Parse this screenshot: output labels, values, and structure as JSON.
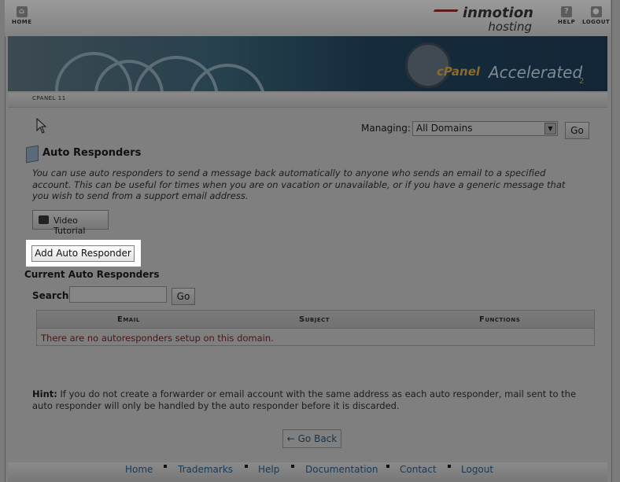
{
  "topbar": {
    "home_label": "HOME",
    "help_label": "HELP",
    "logout_label": "LOGOUT",
    "logo_line1": "inmotion",
    "logo_line2": "hosting"
  },
  "banner": {
    "brand_word1": "cPanel",
    "brand_word2": "Accelerated",
    "brand_suffix": "2"
  },
  "breadcrumb": "CPANEL 11",
  "managing": {
    "label": "Managing:",
    "selected": "All Domains",
    "go_label": "Go"
  },
  "page": {
    "title": "Auto Responders",
    "description": "You can use auto responders to send a message back automatically to anyone who sends an email to a specified account. This can be useful for times when you are on vacation or unavailable, or if you have a generic message that you wish to send from a support email address.",
    "video_tutorial_label": "Video Tutorial",
    "add_button_label": "Add Auto Responder",
    "current_heading": "Current Auto Responders"
  },
  "search": {
    "label": "Search",
    "value": "",
    "go_label": "Go"
  },
  "table": {
    "columns": [
      "Email",
      "Subject",
      "Functions"
    ],
    "empty_message": "There are no autoresponders setup on this domain."
  },
  "hint": {
    "label": "Hint:",
    "text": " If you do not create a forwarder or email account with the same address as each auto responder, mail sent to the auto responder will only be handled by the auto responder before it is discarded."
  },
  "go_back_label": "← Go Back",
  "footer": {
    "links": [
      "Home",
      "Trademarks",
      "Help",
      "Documentation",
      "Contact",
      "Logout"
    ]
  },
  "colors": {
    "overlay_gray": "#7f7f7f",
    "highlight": "#ffffff",
    "link": "#173a5a"
  }
}
